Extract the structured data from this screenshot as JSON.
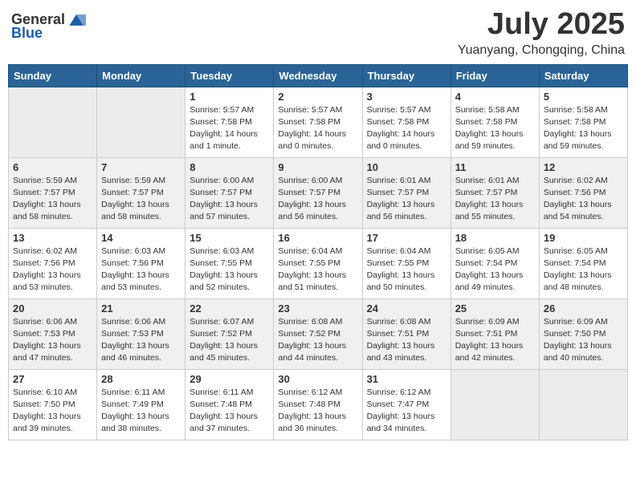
{
  "header": {
    "logo_general": "General",
    "logo_blue": "Blue",
    "month": "July 2025",
    "location": "Yuanyang, Chongqing, China"
  },
  "weekdays": [
    "Sunday",
    "Monday",
    "Tuesday",
    "Wednesday",
    "Thursday",
    "Friday",
    "Saturday"
  ],
  "weeks": [
    [
      {
        "day": "",
        "info": ""
      },
      {
        "day": "",
        "info": ""
      },
      {
        "day": "1",
        "info": "Sunrise: 5:57 AM\nSunset: 7:58 PM\nDaylight: 14 hours\nand 1 minute."
      },
      {
        "day": "2",
        "info": "Sunrise: 5:57 AM\nSunset: 7:58 PM\nDaylight: 14 hours\nand 0 minutes."
      },
      {
        "day": "3",
        "info": "Sunrise: 5:57 AM\nSunset: 7:58 PM\nDaylight: 14 hours\nand 0 minutes."
      },
      {
        "day": "4",
        "info": "Sunrise: 5:58 AM\nSunset: 7:58 PM\nDaylight: 13 hours\nand 59 minutes."
      },
      {
        "day": "5",
        "info": "Sunrise: 5:58 AM\nSunset: 7:58 PM\nDaylight: 13 hours\nand 59 minutes."
      }
    ],
    [
      {
        "day": "6",
        "info": "Sunrise: 5:59 AM\nSunset: 7:57 PM\nDaylight: 13 hours\nand 58 minutes."
      },
      {
        "day": "7",
        "info": "Sunrise: 5:59 AM\nSunset: 7:57 PM\nDaylight: 13 hours\nand 58 minutes."
      },
      {
        "day": "8",
        "info": "Sunrise: 6:00 AM\nSunset: 7:57 PM\nDaylight: 13 hours\nand 57 minutes."
      },
      {
        "day": "9",
        "info": "Sunrise: 6:00 AM\nSunset: 7:57 PM\nDaylight: 13 hours\nand 56 minutes."
      },
      {
        "day": "10",
        "info": "Sunrise: 6:01 AM\nSunset: 7:57 PM\nDaylight: 13 hours\nand 56 minutes."
      },
      {
        "day": "11",
        "info": "Sunrise: 6:01 AM\nSunset: 7:57 PM\nDaylight: 13 hours\nand 55 minutes."
      },
      {
        "day": "12",
        "info": "Sunrise: 6:02 AM\nSunset: 7:56 PM\nDaylight: 13 hours\nand 54 minutes."
      }
    ],
    [
      {
        "day": "13",
        "info": "Sunrise: 6:02 AM\nSunset: 7:56 PM\nDaylight: 13 hours\nand 53 minutes."
      },
      {
        "day": "14",
        "info": "Sunrise: 6:03 AM\nSunset: 7:56 PM\nDaylight: 13 hours\nand 53 minutes."
      },
      {
        "day": "15",
        "info": "Sunrise: 6:03 AM\nSunset: 7:55 PM\nDaylight: 13 hours\nand 52 minutes."
      },
      {
        "day": "16",
        "info": "Sunrise: 6:04 AM\nSunset: 7:55 PM\nDaylight: 13 hours\nand 51 minutes."
      },
      {
        "day": "17",
        "info": "Sunrise: 6:04 AM\nSunset: 7:55 PM\nDaylight: 13 hours\nand 50 minutes."
      },
      {
        "day": "18",
        "info": "Sunrise: 6:05 AM\nSunset: 7:54 PM\nDaylight: 13 hours\nand 49 minutes."
      },
      {
        "day": "19",
        "info": "Sunrise: 6:05 AM\nSunset: 7:54 PM\nDaylight: 13 hours\nand 48 minutes."
      }
    ],
    [
      {
        "day": "20",
        "info": "Sunrise: 6:06 AM\nSunset: 7:53 PM\nDaylight: 13 hours\nand 47 minutes."
      },
      {
        "day": "21",
        "info": "Sunrise: 6:06 AM\nSunset: 7:53 PM\nDaylight: 13 hours\nand 46 minutes."
      },
      {
        "day": "22",
        "info": "Sunrise: 6:07 AM\nSunset: 7:52 PM\nDaylight: 13 hours\nand 45 minutes."
      },
      {
        "day": "23",
        "info": "Sunrise: 6:08 AM\nSunset: 7:52 PM\nDaylight: 13 hours\nand 44 minutes."
      },
      {
        "day": "24",
        "info": "Sunrise: 6:08 AM\nSunset: 7:51 PM\nDaylight: 13 hours\nand 43 minutes."
      },
      {
        "day": "25",
        "info": "Sunrise: 6:09 AM\nSunset: 7:51 PM\nDaylight: 13 hours\nand 42 minutes."
      },
      {
        "day": "26",
        "info": "Sunrise: 6:09 AM\nSunset: 7:50 PM\nDaylight: 13 hours\nand 40 minutes."
      }
    ],
    [
      {
        "day": "27",
        "info": "Sunrise: 6:10 AM\nSunset: 7:50 PM\nDaylight: 13 hours\nand 39 minutes."
      },
      {
        "day": "28",
        "info": "Sunrise: 6:11 AM\nSunset: 7:49 PM\nDaylight: 13 hours\nand 38 minutes."
      },
      {
        "day": "29",
        "info": "Sunrise: 6:11 AM\nSunset: 7:48 PM\nDaylight: 13 hours\nand 37 minutes."
      },
      {
        "day": "30",
        "info": "Sunrise: 6:12 AM\nSunset: 7:48 PM\nDaylight: 13 hours\nand 36 minutes."
      },
      {
        "day": "31",
        "info": "Sunrise: 6:12 AM\nSunset: 7:47 PM\nDaylight: 13 hours\nand 34 minutes."
      },
      {
        "day": "",
        "info": ""
      },
      {
        "day": "",
        "info": ""
      }
    ]
  ]
}
